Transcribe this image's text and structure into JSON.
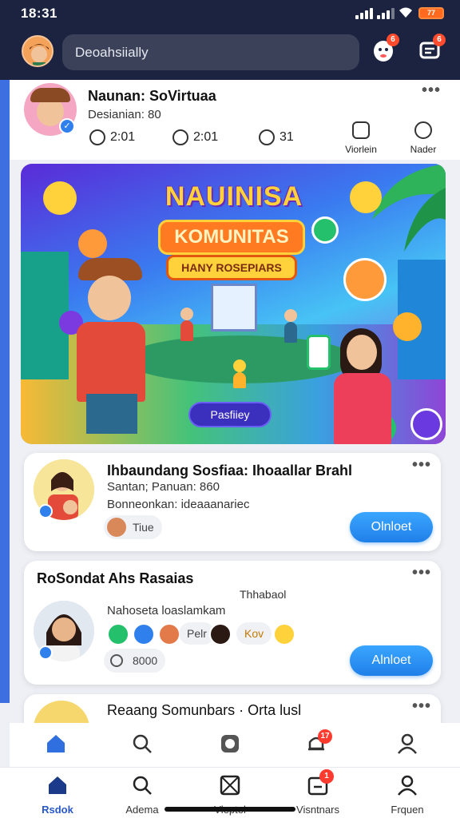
{
  "status": {
    "time": "18:31",
    "battery": "77"
  },
  "header": {
    "search_placeholder": "Deoahsiially",
    "bell_badge": "6",
    "chat_badge": "6"
  },
  "post": {
    "author": "Naunan: SoVirtuaa",
    "subtitle": "Desianian: 80",
    "stats": [
      {
        "label": "2:01"
      },
      {
        "label": "2:01"
      },
      {
        "label": "31"
      }
    ],
    "actions": [
      {
        "label": "Viorlein"
      },
      {
        "label": "Nader"
      }
    ]
  },
  "banner": {
    "title_line1": "NAUINISA",
    "title_line2": "KOMUNITAS",
    "title_line3": "HANY ROSEPIARS",
    "cta": "Pasfiiey"
  },
  "cards": [
    {
      "title": "Ihbaundang Sosfiaa: Ihoaallar Brahl",
      "line1": "Santan; Panuan: 860",
      "line2": "Bonneonkan: ideaaanariec",
      "chip": "Tiue",
      "button": "Olnloet"
    },
    {
      "title": "RoSondat Ahs Rasaias",
      "right_note": "Thhabaol",
      "line1": "Nahoseta loaslamkam",
      "pill1": "Pelr",
      "pill2": "Kov",
      "chip": "8000",
      "button": "Alnloet"
    },
    {
      "title": "Reaang Somunbars · Orta lusl"
    }
  ],
  "nav_top": [
    {
      "name": "home"
    },
    {
      "name": "search"
    },
    {
      "name": "record"
    },
    {
      "name": "notifications",
      "badge": "17"
    },
    {
      "name": "profile"
    }
  ],
  "nav_bottom": [
    {
      "label": "Rsdok"
    },
    {
      "label": "Adema"
    },
    {
      "label": "Vleptel"
    },
    {
      "label": "Visntnars",
      "badge": "1"
    },
    {
      "label": "Frquen"
    }
  ],
  "colors": {
    "topbar": "#1c2340",
    "accent": "#2f80ed",
    "badge": "#ff3b30"
  }
}
